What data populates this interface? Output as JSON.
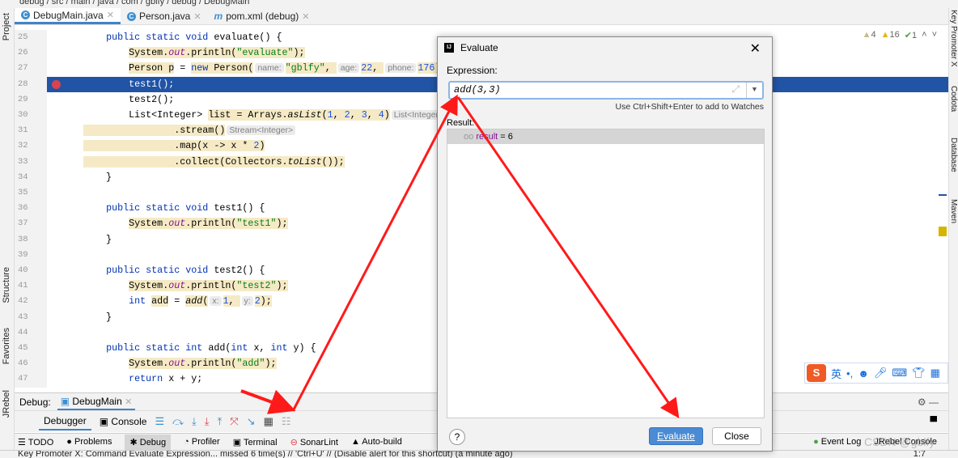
{
  "breadcrumb": "debug / src / main / java / com / gblfy / debug / DebugMain",
  "left_strip": {
    "project": "Project",
    "structure": "Structure",
    "favorites": "Favorites",
    "jrebel": "JRebel"
  },
  "right_strip": {
    "key_promoter": "Key Promoter X",
    "codota": "Codota",
    "database": "Database",
    "maven": "Maven"
  },
  "tabs": [
    {
      "label": "DebugMain.java",
      "icon": "class-icon"
    },
    {
      "label": "Person.java",
      "icon": "class-icon"
    },
    {
      "label": "pom.xml (debug)",
      "icon": "maven-icon"
    }
  ],
  "inspections": {
    "weak_warnings": "4",
    "warnings": "16",
    "typos": "1"
  },
  "code": [
    {
      "n": "25",
      "t": [
        [
          "    "
        ],
        [
          "public static void ",
          "kw"
        ],
        [
          "evaluate() {"
        ]
      ]
    },
    {
      "n": "26",
      "t": [
        [
          "        "
        ],
        [
          "System.",
          "hl"
        ],
        [
          "out",
          "fld hl"
        ],
        [
          ".println(",
          "hl"
        ],
        [
          "\"evaluate\"",
          "str hl"
        ],
        [
          ");",
          "hl"
        ]
      ]
    },
    {
      "n": "27",
      "t": [
        [
          "        "
        ],
        [
          "Person ",
          "hl"
        ],
        [
          "p",
          "hl"
        ],
        [
          " = ",
          ""
        ],
        [
          "new ",
          "kw hl"
        ],
        [
          "Person(",
          "hl"
        ],
        [
          "name:",
          "hint"
        ],
        [
          "\"gblfy\"",
          "str hl"
        ],
        [
          ", ",
          "hl"
        ],
        [
          "age:",
          "hint"
        ],
        [
          "22",
          "num hl"
        ],
        [
          ", ",
          "hl"
        ],
        [
          "phone:",
          "hint"
        ],
        [
          "176",
          "num hl"
        ],
        [
          ");",
          "hl"
        ]
      ]
    },
    {
      "n": "28",
      "cur": true,
      "bp": true,
      "t": [
        [
          "        "
        ],
        [
          "test1",
          "it"
        ],
        [
          "();"
        ]
      ]
    },
    {
      "n": "29",
      "t": [
        [
          "        test2();"
        ]
      ]
    },
    {
      "n": "30",
      "t": [
        [
          "        List<Integer> "
        ],
        [
          "list",
          "hl"
        ],
        [
          " = Arrays.",
          "hl"
        ],
        [
          "asList",
          "it hl"
        ],
        [
          "(",
          "hl"
        ],
        [
          "1",
          "num hl"
        ],
        [
          ", ",
          "hl"
        ],
        [
          "2",
          "num hl"
        ],
        [
          ", ",
          "hl"
        ],
        [
          "3",
          "num hl"
        ],
        [
          ", ",
          "hl"
        ],
        [
          "4",
          "num hl"
        ],
        [
          ")",
          "hl"
        ],
        [
          "List<Integer>",
          "hint"
        ]
      ]
    },
    {
      "n": "31",
      "t": [
        [
          "                .stream()",
          "hl"
        ],
        [
          "Stream<Integer>",
          "hint"
        ]
      ]
    },
    {
      "n": "32",
      "t": [
        [
          "                .map(x -> x * ",
          "hl"
        ],
        [
          "2",
          "num hl"
        ],
        [
          ")",
          "hl"
        ]
      ]
    },
    {
      "n": "33",
      "t": [
        [
          "                .collect(Collectors.",
          "hl"
        ],
        [
          "toList",
          "it hl"
        ],
        [
          "());",
          "hl"
        ]
      ]
    },
    {
      "n": "34",
      "t": [
        [
          "    }"
        ]
      ]
    },
    {
      "n": "35",
      "t": [
        [
          ""
        ]
      ]
    },
    {
      "n": "36",
      "t": [
        [
          "    "
        ],
        [
          "public static void ",
          "kw"
        ],
        [
          "test1() {"
        ]
      ]
    },
    {
      "n": "37",
      "t": [
        [
          "        "
        ],
        [
          "System.",
          "hl"
        ],
        [
          "out",
          "fld hl"
        ],
        [
          ".println(",
          "hl"
        ],
        [
          "\"test1\"",
          "str hl"
        ],
        [
          ");",
          "hl"
        ]
      ]
    },
    {
      "n": "38",
      "t": [
        [
          "    }"
        ]
      ]
    },
    {
      "n": "39",
      "t": [
        [
          ""
        ]
      ]
    },
    {
      "n": "40",
      "t": [
        [
          "    "
        ],
        [
          "public static void ",
          "kw"
        ],
        [
          "test2() {"
        ]
      ]
    },
    {
      "n": "41",
      "t": [
        [
          "        "
        ],
        [
          "System.",
          "hl"
        ],
        [
          "out",
          "fld hl"
        ],
        [
          ".println(",
          "hl"
        ],
        [
          "\"test2\"",
          "str hl"
        ],
        [
          ");",
          "hl"
        ]
      ]
    },
    {
      "n": "42",
      "t": [
        [
          "        "
        ],
        [
          "int ",
          "kw"
        ],
        [
          "add",
          "hl"
        ],
        [
          " = "
        ],
        [
          "add",
          "it hl"
        ],
        [
          "(",
          "hl"
        ],
        [
          "x:",
          "hint"
        ],
        [
          "1",
          "num hl"
        ],
        [
          ", ",
          "hl"
        ],
        [
          "y:",
          "hint"
        ],
        [
          "2",
          "num hl"
        ],
        [
          ");",
          "hl"
        ]
      ]
    },
    {
      "n": "43",
      "t": [
        [
          "    }"
        ]
      ]
    },
    {
      "n": "44",
      "t": [
        [
          ""
        ]
      ]
    },
    {
      "n": "45",
      "t": [
        [
          "    "
        ],
        [
          "public static int ",
          "kw"
        ],
        [
          "add("
        ],
        [
          "int ",
          "kw"
        ],
        [
          "x, "
        ],
        [
          "int ",
          "kw"
        ],
        [
          "y) {"
        ]
      ]
    },
    {
      "n": "46",
      "t": [
        [
          "        "
        ],
        [
          "System.",
          "hl"
        ],
        [
          "out",
          "fld hl"
        ],
        [
          ".println(",
          "hl"
        ],
        [
          "\"add\"",
          "str hl"
        ],
        [
          ");",
          "hl"
        ]
      ]
    },
    {
      "n": "47",
      "t": [
        [
          "        "
        ],
        [
          "return ",
          "kw"
        ],
        [
          "x + y;"
        ]
      ]
    }
  ],
  "debug": {
    "label": "Debug:",
    "session": "DebugMain",
    "tab_debugger": "Debugger",
    "tab_console": "Console"
  },
  "tool_windows": [
    "TODO",
    "Problems",
    "Debug",
    "Profiler",
    "Terminal",
    "SonarLint",
    "Auto-build"
  ],
  "tool_windows_right": [
    "Event Log",
    "JRebel Console"
  ],
  "status": "Key Promoter X: Command Evaluate Expression... missed 6 time(s) // 'Ctrl+U' // (Disable alert for this shortcut) (a minute ago)",
  "caret": "1:7",
  "watermark": "CSDN @gblfy",
  "ime": {
    "lang": "英",
    "punct": "•,"
  },
  "dialog": {
    "title": "Evaluate",
    "expression_label": "Expression:",
    "expression": "add(3,3)",
    "hint": "Use Ctrl+Shift+Enter to add to Watches",
    "result_label": "Result:",
    "result_name": "result",
    "result_value": "= 6",
    "evaluate": "Evaluate",
    "close": "Close",
    "help": "?"
  },
  "colors": {
    "current_line": "#2154a5",
    "highlight": "#f5eac5",
    "annotation_arrow": "#ff1a1a",
    "primary_button": "#4a8bd4"
  }
}
